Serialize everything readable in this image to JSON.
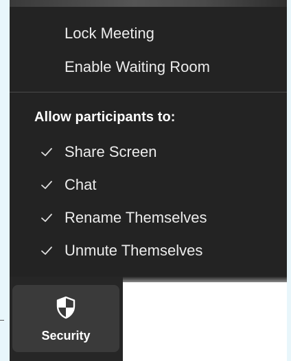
{
  "security_menu": {
    "items": [
      {
        "label": "Lock Meeting"
      },
      {
        "label": "Enable Waiting Room"
      }
    ],
    "section_header": "Allow participants to:",
    "permissions": [
      {
        "label": "Share Screen",
        "checked": true
      },
      {
        "label": "Chat",
        "checked": true
      },
      {
        "label": "Rename Themselves",
        "checked": true
      },
      {
        "label": "Unmute Themselves",
        "checked": true
      }
    ]
  },
  "toolbar": {
    "security_label": "Security",
    "security_icon": "shield-icon"
  },
  "colors": {
    "menu_background": "#232323",
    "menu_text": "#ececec",
    "button_background": "#3a3a3a",
    "page_background": "#e8f6fb"
  }
}
